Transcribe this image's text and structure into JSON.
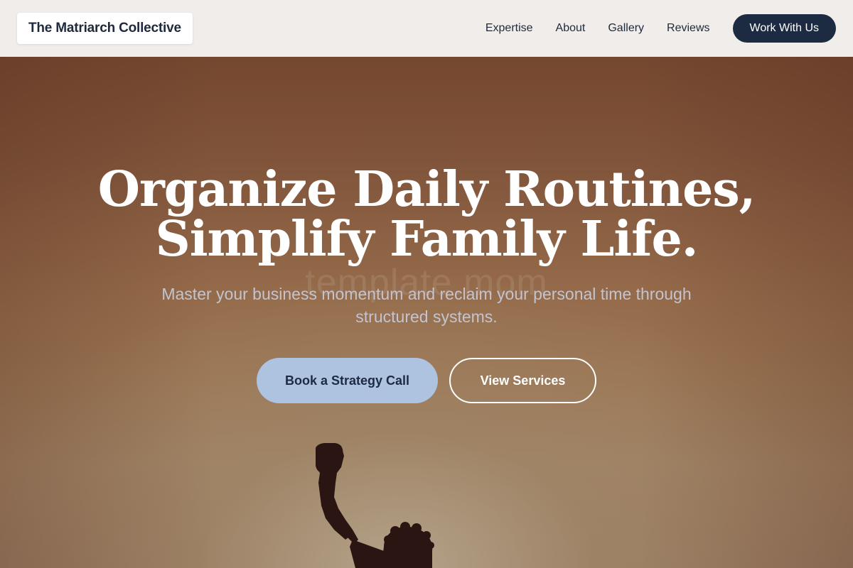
{
  "header": {
    "brand": "The Matriarch Collective",
    "nav": [
      {
        "label": "Expertise"
      },
      {
        "label": "About"
      },
      {
        "label": "Gallery"
      },
      {
        "label": "Reviews"
      }
    ],
    "cta_label": "Work With Us"
  },
  "hero": {
    "title_line1": "Organize Daily Routines,",
    "title_line2": "Simplify Family Life.",
    "watermark": "template.mom",
    "subtitle": "Master your business momentum and reclaim your personal time through structured systems.",
    "primary_button": "Book a Strategy Call",
    "secondary_button": "View Services"
  },
  "colors": {
    "navy": "#1c2a42",
    "light_blue": "#aec3df",
    "header_bg": "#f1edea",
    "hero_warm": "#8a5a3c"
  }
}
